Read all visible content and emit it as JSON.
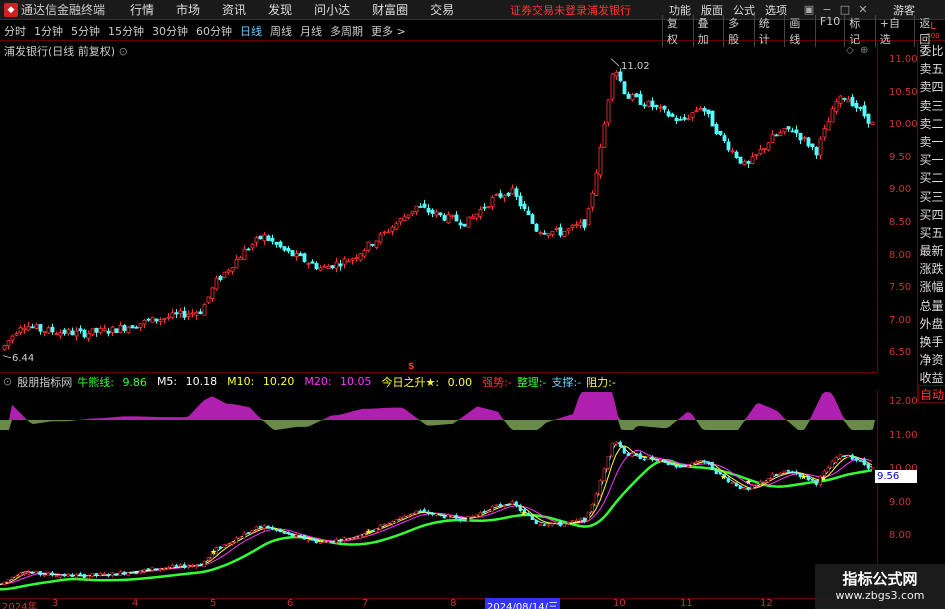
{
  "titlebar": {
    "app_name": "通达信金融终端",
    "menu": [
      "行情",
      "市场",
      "资讯",
      "发现",
      "问小达",
      "财富圈",
      "交易"
    ],
    "status": "证券交易未登录",
    "stock_name": "浦发银行",
    "right_menu": [
      "功能",
      "版面",
      "公式",
      "选项"
    ],
    "guest": "游客"
  },
  "periodbar": {
    "tabs": [
      "分时",
      "1分钟",
      "5分钟",
      "15分钟",
      "30分钟",
      "60分钟",
      "日线",
      "周线",
      "月线",
      "多周期",
      "更多 >"
    ],
    "active_tab": "日线",
    "tools": [
      "复权",
      "叠加",
      "多股",
      "统计",
      "画线",
      "F10",
      "标记",
      "+自选",
      "返回"
    ],
    "lbox": "L",
    "lbox_sub": "300"
  },
  "chart": {
    "title": "浦发银行(日线 前复权)",
    "high_label": "11.02",
    "low_label": "6.44",
    "price_ticks": [
      "11.00",
      "10.50",
      "10.00",
      "9.50",
      "9.00",
      "8.50",
      "8.00",
      "7.50",
      "7.00",
      "6.50"
    ]
  },
  "sidepanel": [
    "委比",
    "卖五",
    "卖四",
    "卖三",
    "卖二",
    "卖一",
    "买一",
    "买二",
    "买三",
    "买四",
    "买五",
    "最新",
    "涨跌",
    "涨幅",
    "总量",
    "外盘",
    "换手",
    "净资",
    "收益"
  ],
  "sidepanel_auto": "自动",
  "indicator": {
    "name": "殷朋指标网",
    "niuxian_label": "牛熊线:",
    "niuxian_value": "9.86",
    "m5_label": "M5:",
    "m5_value": "10.18",
    "m10_label": "M10:",
    "m10_value": "10.20",
    "m20_label": "M20:",
    "m20_value": "10.05",
    "today_label": "今日之升★:",
    "today_value": "0.00",
    "qiangshi": "强势:-",
    "zhengli": "整理:-",
    "zhicheng": "支撑:-",
    "zuli": "阻力:-",
    "ticks": [
      "12.00",
      "11.00",
      "10.00",
      "9.00",
      "8.00"
    ],
    "price_tag": "9.56"
  },
  "date_axis": {
    "labels": [
      "2024年",
      "3",
      "4",
      "5",
      "6",
      "7",
      "8",
      "10",
      "11",
      "12"
    ],
    "selected": "2024/08/14/三"
  },
  "watermark": {
    "title": "指标公式网",
    "url": "www.zbgs3.com"
  },
  "colors": {
    "up": "#ff3333",
    "down": "#54ffff",
    "axis": "#cc3333",
    "green_line": "#33ff33",
    "purple": "#b020b0",
    "olive": "#6a8a4a"
  }
}
